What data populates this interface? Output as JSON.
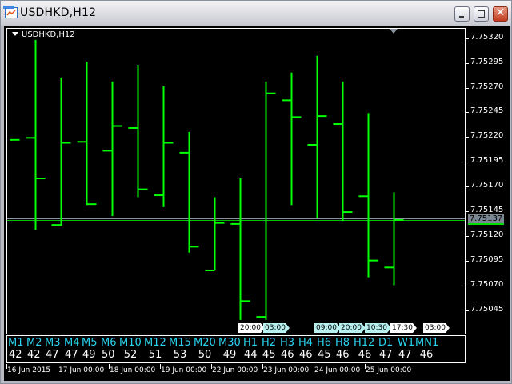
{
  "window": {
    "title": "USDHKD,H12"
  },
  "chart": {
    "label": "USDHKD,H12",
    "bid_price": "7.75137"
  },
  "time_labels": [
    {
      "text": "20:00",
      "color": "#ffffff"
    },
    {
      "text": "03:00",
      "color": "#b8f0f0"
    },
    {
      "text": "09:00",
      "color": "#b8f0f0"
    },
    {
      "text": "20:00",
      "color": "#b8f0f0"
    },
    {
      "text": "10:30",
      "color": "#b8f0f0"
    },
    {
      "text": "17:30",
      "color": "#ffffff"
    },
    {
      "text": "03:00",
      "color": "#ffffff"
    }
  ],
  "timeframes": [
    {
      "tf": "M1",
      "v": "42"
    },
    {
      "tf": "M2",
      "v": "42"
    },
    {
      "tf": "M3",
      "v": "47"
    },
    {
      "tf": "M4",
      "v": "47"
    },
    {
      "tf": "M5",
      "v": "49"
    },
    {
      "tf": "M6",
      "v": "50"
    },
    {
      "tf": "M10",
      "v": "52"
    },
    {
      "tf": "M12",
      "v": "51"
    },
    {
      "tf": "M15",
      "v": "53"
    },
    {
      "tf": "M20",
      "v": "50"
    },
    {
      "tf": "M30",
      "v": "49"
    },
    {
      "tf": "H1",
      "v": "44"
    },
    {
      "tf": "H2",
      "v": "45"
    },
    {
      "tf": "H3",
      "v": "46"
    },
    {
      "tf": "H4",
      "v": "46"
    },
    {
      "tf": "H6",
      "v": "45"
    },
    {
      "tf": "H8",
      "v": "46"
    },
    {
      "tf": "H12",
      "v": "46"
    },
    {
      "tf": "D1",
      "v": "47"
    },
    {
      "tf": "W1",
      "v": "47"
    },
    {
      "tf": "MN1",
      "v": "46"
    }
  ],
  "chart_data": {
    "type": "ohlc",
    "symbol": "USDHKD",
    "timeframe": "H12",
    "ylim": [
      7.75025,
      7.7534
    ],
    "y_ticks": [
      "7.75320",
      "7.75295",
      "7.75270",
      "7.75245",
      "7.75220",
      "7.75195",
      "7.75170",
      "7.75145",
      "7.75120",
      "7.75095",
      "7.75070",
      "7.75045"
    ],
    "x_ticks": [
      "16 Jun 2015",
      "17 Jun 00:00",
      "18 Jun 00:00",
      "19 Jun 00:00",
      "22 Jun 00:00",
      "23 Jun 00:00",
      "24 Jun 00:00",
      "25 Jun 00:00"
    ],
    "bid": 7.75137,
    "bars": [
      {
        "o": 7.75218,
        "h": 7.75218,
        "l": 7.75218,
        "c": 7.75218
      },
      {
        "o": 7.7522,
        "h": 7.75319,
        "l": 7.75127,
        "c": 7.75179
      },
      {
        "o": 7.75132,
        "h": 7.75281,
        "l": 7.75131,
        "c": 7.75215
      },
      {
        "o": 7.75216,
        "h": 7.75297,
        "l": 7.75152,
        "c": 7.75153
      },
      {
        "o": 7.75207,
        "h": 7.75277,
        "l": 7.75141,
        "c": 7.75232
      },
      {
        "o": 7.7523,
        "h": 7.75294,
        "l": 7.7516,
        "c": 7.75168
      },
      {
        "o": 7.75162,
        "h": 7.75272,
        "l": 7.7515,
        "c": 7.75215
      },
      {
        "o": 7.75205,
        "h": 7.75226,
        "l": 7.75104,
        "c": 7.7511
      },
      {
        "o": 7.75086,
        "h": 7.7516,
        "l": 7.75086,
        "c": 7.75134
      },
      {
        "o": 7.75133,
        "h": 7.75179,
        "l": 7.75036,
        "c": 7.75055
      },
      {
        "o": 7.75039,
        "h": 7.75277,
        "l": 7.75036,
        "c": 7.75265
      },
      {
        "o": 7.75258,
        "h": 7.75286,
        "l": 7.75152,
        "c": 7.75241
      },
      {
        "o": 7.75213,
        "h": 7.75303,
        "l": 7.75139,
        "c": 7.75242
      },
      {
        "o": 7.75234,
        "h": 7.75277,
        "l": 7.75136,
        "c": 7.75145
      },
      {
        "o": 7.75161,
        "h": 7.75245,
        "l": 7.75079,
        "c": 7.75096
      },
      {
        "o": 7.75089,
        "h": 7.75165,
        "l": 7.75071,
        "c": 7.75137
      }
    ],
    "bar_color": "#00ff00"
  }
}
